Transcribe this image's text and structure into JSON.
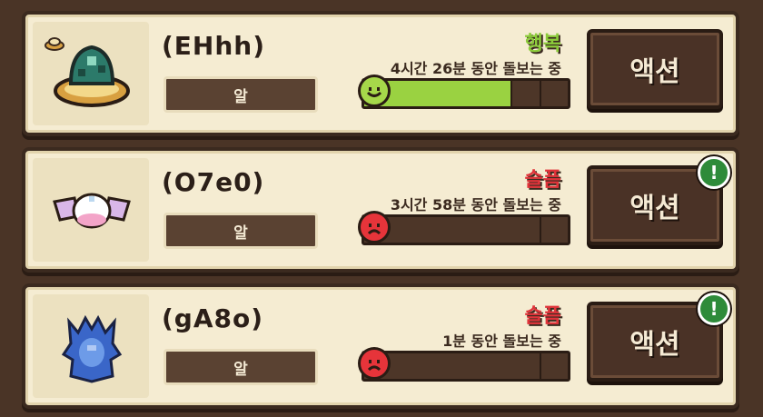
{
  "pets": [
    {
      "name": "(EHhh)",
      "stage": "알",
      "mood": "행복",
      "mood_type": "happy",
      "care_text": "4시간 26분 동안 돌보는 중",
      "progress": 0.72,
      "action_label": "액션",
      "alert": false,
      "alert_icon": "!"
    },
    {
      "name": "(O7e0)",
      "stage": "알",
      "mood": "슬픔",
      "mood_type": "sad",
      "care_text": "3시간 58분 동안 돌보는 중",
      "progress": 0.0,
      "action_label": "액션",
      "alert": true,
      "alert_icon": "!"
    },
    {
      "name": "(gA8o)",
      "stage": "알",
      "mood": "슬픔",
      "mood_type": "sad",
      "care_text": "1분 동안 돌보는 중",
      "progress": 0.0,
      "action_label": "액션",
      "alert": true,
      "alert_icon": "!"
    }
  ],
  "colors": {
    "happy": "#8ccc3a",
    "sad": "#e0333a",
    "bar_fill": "#9ad241",
    "alert": "#2e8b3a"
  }
}
